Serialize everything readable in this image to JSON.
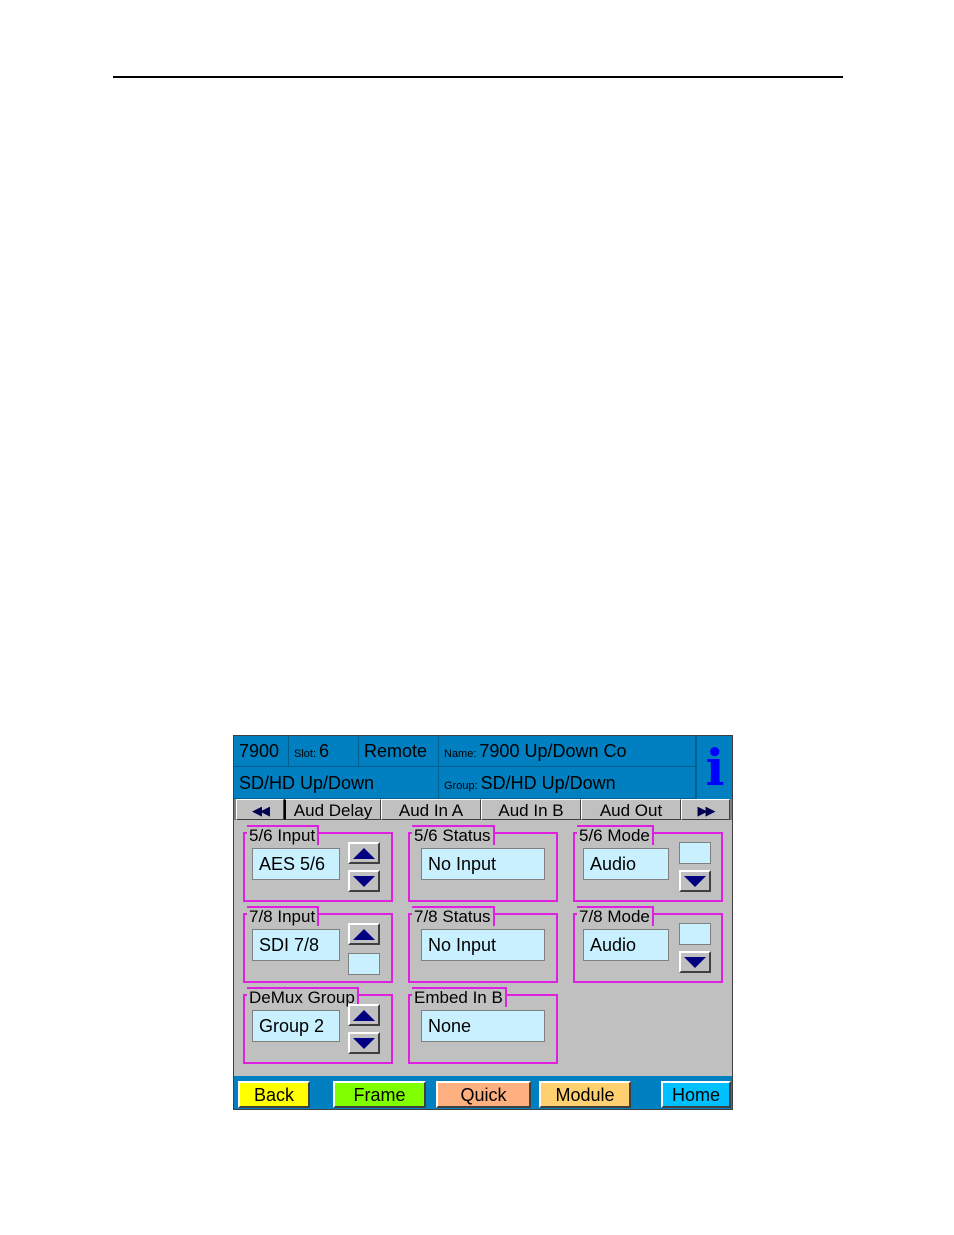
{
  "header": {
    "model": "7900",
    "slot_label": "Slot:",
    "slot_value": "6",
    "mode": "Remote",
    "name_label": "Name:",
    "name_value": "7900 Up/Down Co",
    "card_type": "SD/HD Up/Down",
    "group_label": "Group:",
    "group_value": "SD/HD Up/Down",
    "info_glyph": "i"
  },
  "tabs": {
    "prev": "◀◀",
    "items": [
      "Aud Delay",
      "Aud In A",
      "Aud In B",
      "Aud Out"
    ],
    "next": "▶▶"
  },
  "controls": {
    "in56": {
      "title": "5/6 Input",
      "value": "AES  5/6"
    },
    "st56": {
      "title": "5/6 Status",
      "value": "No Input"
    },
    "md56": {
      "title": "5/6 Mode",
      "value": "Audio"
    },
    "in78": {
      "title": "7/8 Input",
      "value": "SDI 7/8"
    },
    "st78": {
      "title": "7/8 Status",
      "value": "No Input"
    },
    "md78": {
      "title": "7/8 Mode",
      "value": "Audio"
    },
    "demux": {
      "title": "DeMux Group",
      "value": "Group 2"
    },
    "embed": {
      "title": "Embed In B",
      "value": "None"
    }
  },
  "nav": {
    "back": "Back",
    "frame": "Frame",
    "quick": "Quick",
    "module": "Module",
    "home": "Home"
  },
  "colors": {
    "header_bg": "#0080c0",
    "field_bg": "#c8f0ff",
    "group_border": "#e020e0",
    "back": "#ffff00",
    "frame": "#80ff00",
    "quick": "#ffb080",
    "module": "#ffd070",
    "home": "#00c0ff"
  }
}
